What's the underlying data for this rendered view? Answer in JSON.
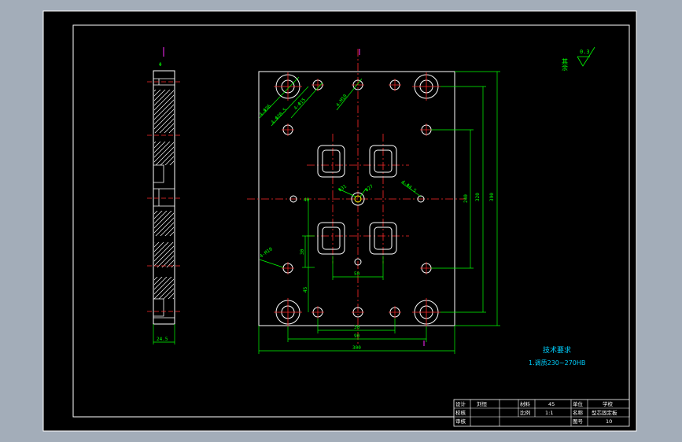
{
  "drawing": {
    "tech_title": "技术要求",
    "tech_item": "1.调质230~270HB",
    "roughness_value": "0.3",
    "roughness_note": "其余",
    "dims": {
      "d_total_h": "390",
      "d_inner_h": "320",
      "d_mid_h": "240",
      "d_total_w": "300",
      "d_inner_w1": "90",
      "d_inner_w2": "30",
      "d_gate_w": "50",
      "d_gate_h": "30",
      "d_left_v": "45",
      "d_side_w": "30",
      "d_center": "40",
      "hole_1": "4-Φ36",
      "hole_2": "4-Φ20.5",
      "hole_3": "4-Φ15",
      "hole_4": "4-M10",
      "hole_5": "4-Φ4.5",
      "hole_6": "4-M10",
      "d_center1": "Φ31",
      "d_center2": "Φ27",
      "side_thk": "24.5"
    }
  },
  "title_block": {
    "design_label": "设计",
    "design_name": "刘恒",
    "check_label": "校核",
    "review_label": "审核",
    "material_label": "材料",
    "material_value": "45",
    "scale_label": "比例",
    "scale_value": "1:1",
    "unit_label": "单位",
    "unit_value": "学校",
    "name_label": "名称",
    "name_value": "型芯固定板",
    "drawing_no_label": "图号",
    "drawing_no_value": "10"
  }
}
